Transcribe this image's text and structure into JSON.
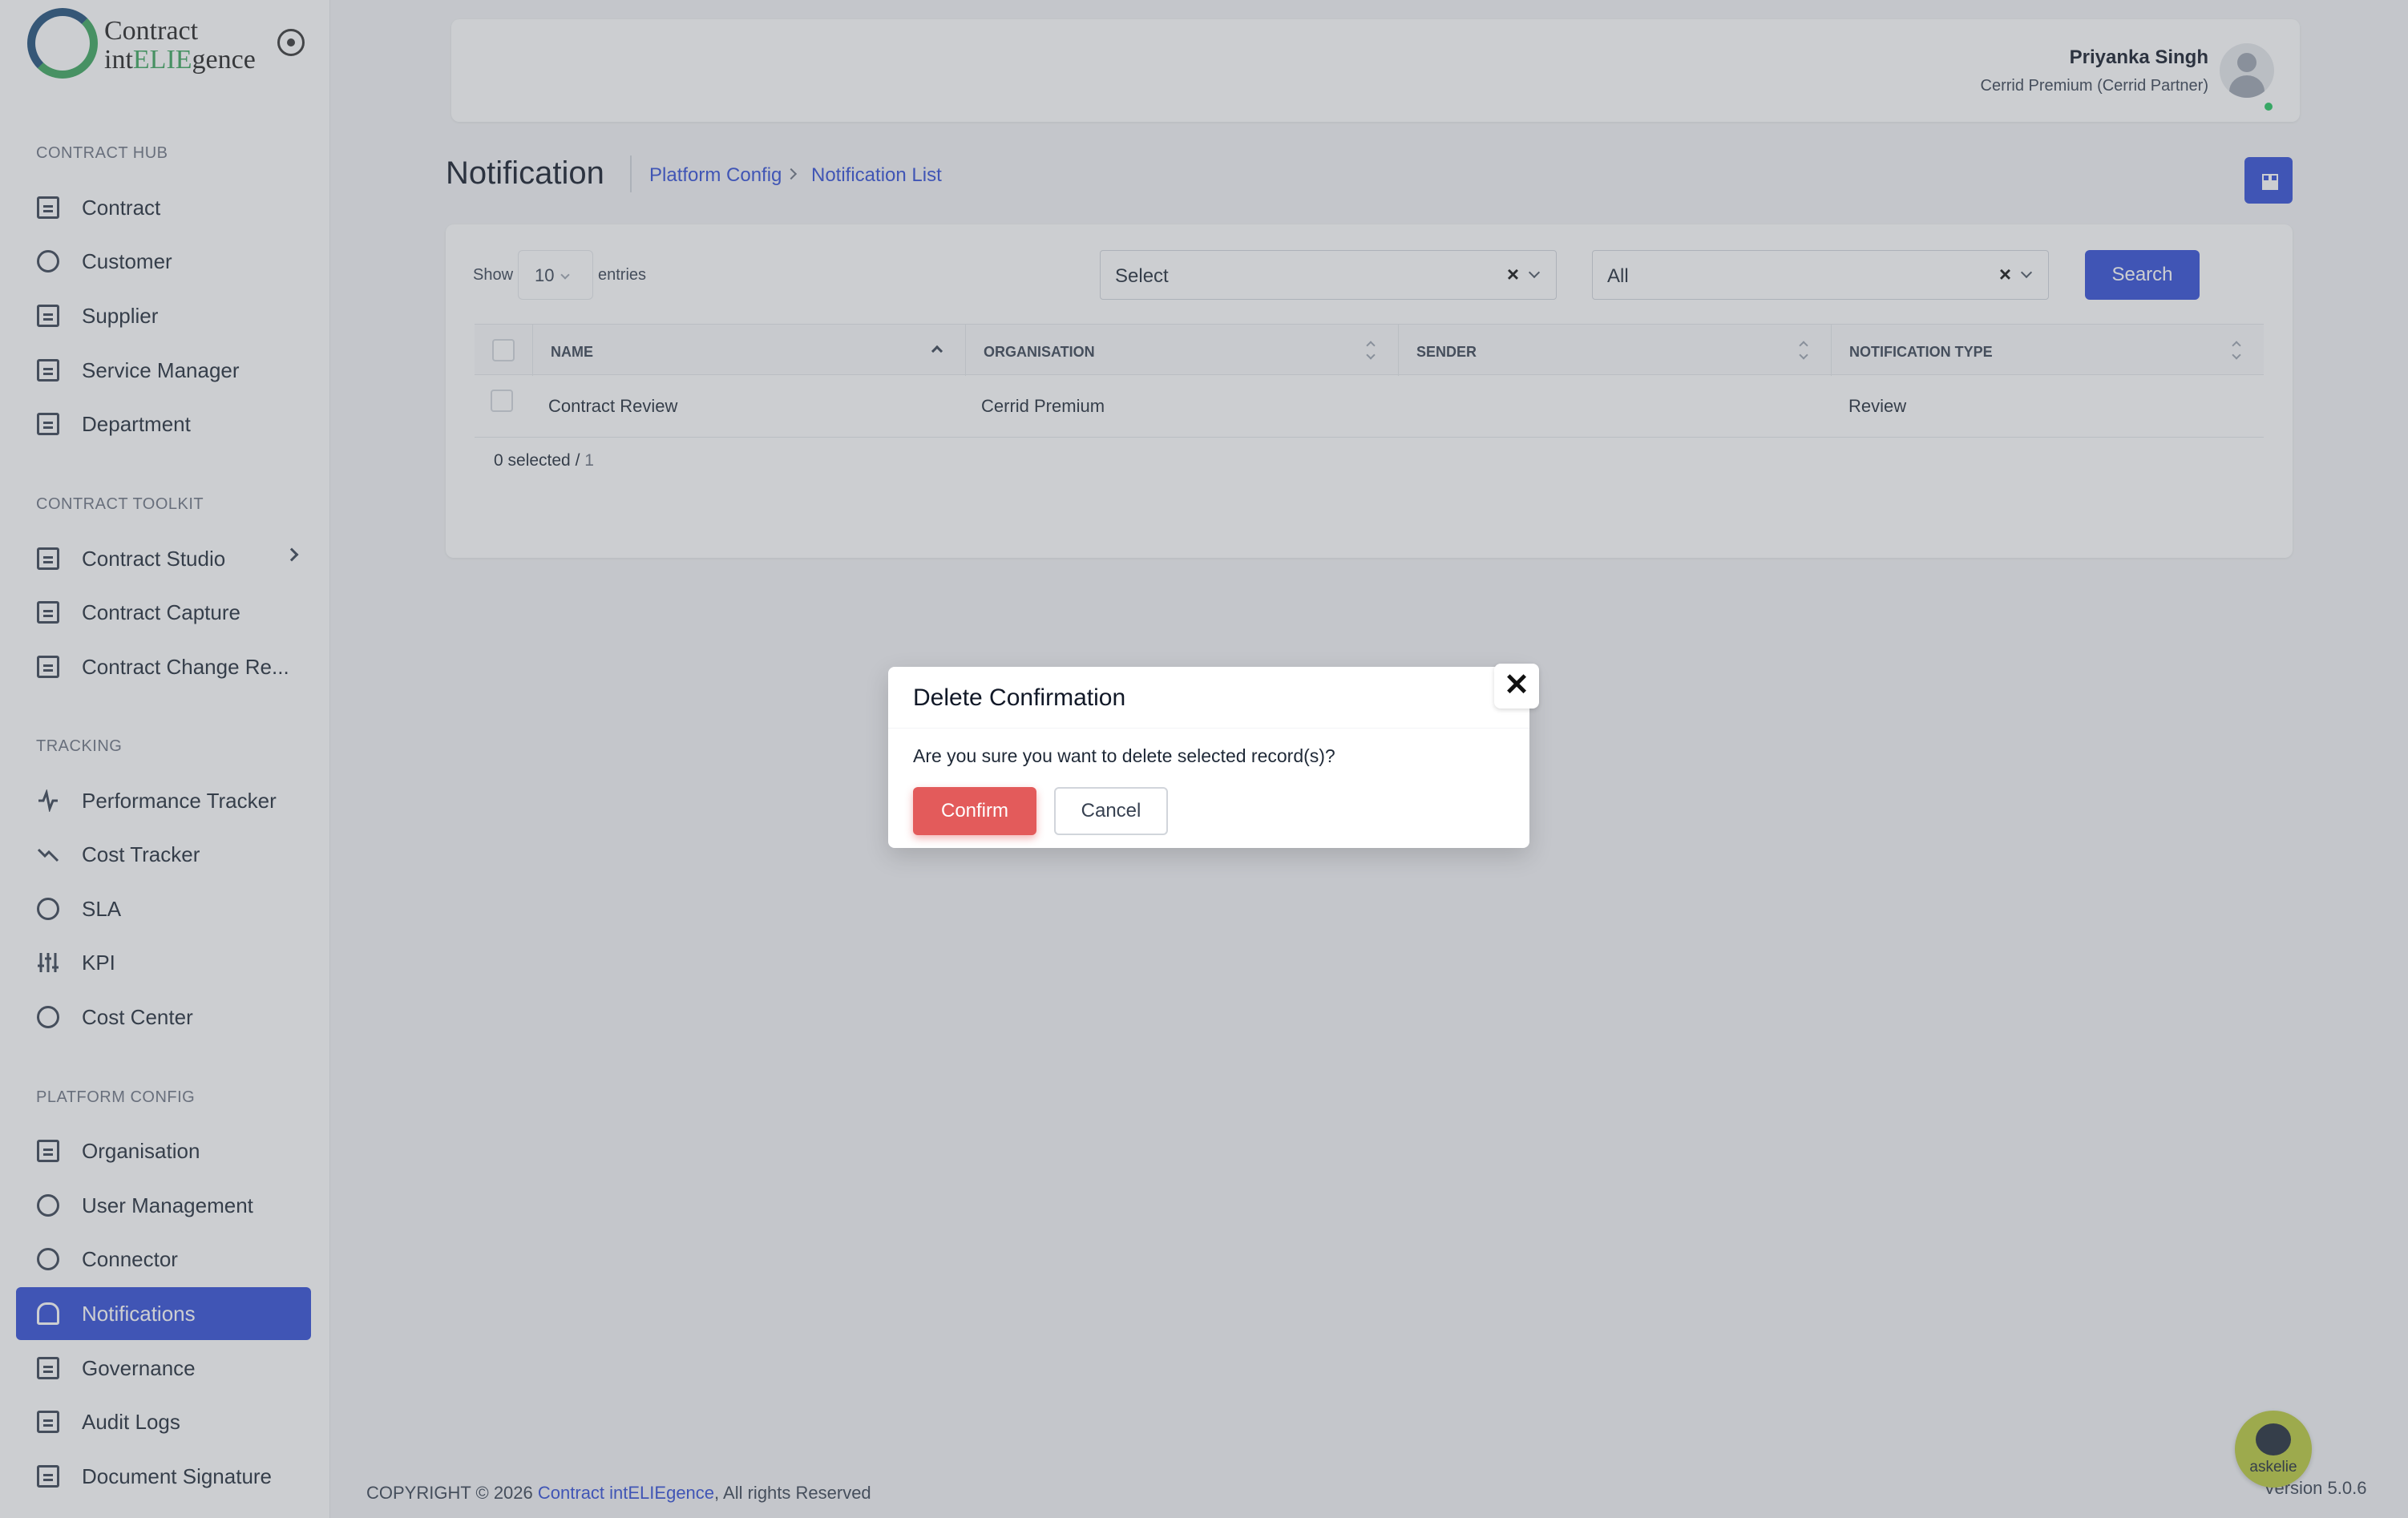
{
  "app": {
    "logo_line1": "Contract",
    "logo_line2_a": "int",
    "logo_line2_b": "ELIE",
    "logo_line2_c": "gence"
  },
  "sidebar": {
    "sections": [
      {
        "title": "CONTRACT HUB",
        "items": [
          {
            "label": "Contract",
            "icon": "document-icon"
          },
          {
            "label": "Customer",
            "icon": "user-icon"
          },
          {
            "label": "Supplier",
            "icon": "truck-icon"
          },
          {
            "label": "Service Manager",
            "icon": "book-icon"
          },
          {
            "label": "Department",
            "icon": "grid-icon"
          }
        ]
      },
      {
        "title": "CONTRACT TOOLKIT",
        "items": [
          {
            "label": "Contract Studio",
            "icon": "document-icon"
          },
          {
            "label": "Contract Capture",
            "icon": "document-icon"
          },
          {
            "label": "Contract Change Re...",
            "icon": "document-icon"
          }
        ]
      },
      {
        "title": "TRACKING",
        "items": [
          {
            "label": "Performance Tracker",
            "icon": "activity-icon"
          },
          {
            "label": "Cost Tracker",
            "icon": "trending-down-icon"
          },
          {
            "label": "SLA",
            "icon": "pen-tool-icon"
          },
          {
            "label": "KPI",
            "icon": "sliders-icon"
          },
          {
            "label": "Cost Center",
            "icon": "paperclip-icon"
          }
        ]
      },
      {
        "title": "PLATFORM CONFIG",
        "items": [
          {
            "label": "Organisation",
            "icon": "calendar-icon"
          },
          {
            "label": "User Management",
            "icon": "users-icon"
          },
          {
            "label": "Connector",
            "icon": "paperclip-icon"
          },
          {
            "label": "Notifications",
            "icon": "bell-icon",
            "active": true
          },
          {
            "label": "Governance",
            "icon": "document-icon"
          },
          {
            "label": "Audit Logs",
            "icon": "book-icon"
          },
          {
            "label": "Document Signature",
            "icon": "document-icon"
          }
        ]
      }
    ]
  },
  "user": {
    "name": "Priyanka Singh",
    "role": "Cerrid Premium (Cerrid Partner)"
  },
  "page": {
    "title": "Notification",
    "breadcrumb": [
      "Platform Config",
      "Notification List"
    ]
  },
  "filters": {
    "show_label": "Show",
    "page_size": "10",
    "entries_label": "entries",
    "filter1": "Select",
    "filter2": "All",
    "clear_glyph": "×",
    "search_label": "Search"
  },
  "table": {
    "columns": [
      "NAME",
      "ORGANISATION",
      "SENDER",
      "NOTIFICATION TYPE"
    ],
    "rows": [
      {
        "name": "Contract Review",
        "organisation": "Cerrid Premium",
        "sender": "",
        "type": "Review"
      }
    ],
    "selected_text": "0 selected / ",
    "total": "1"
  },
  "footer": {
    "prefix": "COPYRIGHT © 2026 ",
    "link": "Contract intELIEgence",
    "suffix": ", All rights Reserved",
    "version": "Version 5.0.6"
  },
  "bot": {
    "label": "askelie"
  },
  "modal": {
    "title": "Delete Confirmation",
    "message": "Are you sure you want to delete selected record(s)?",
    "confirm": "Confirm",
    "cancel": "Cancel",
    "close_glyph": "✕"
  },
  "colors": {
    "accent": "#2f4bd6",
    "danger": "#e35b5b",
    "brand_green": "#3aa55b"
  }
}
